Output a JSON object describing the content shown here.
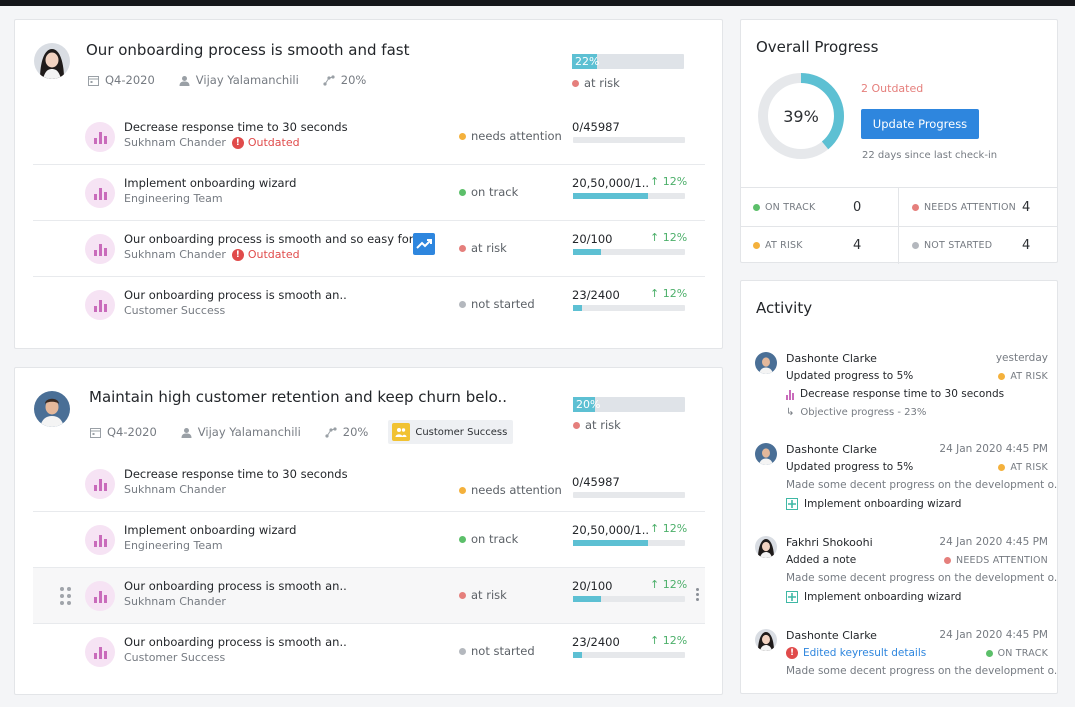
{
  "objectives": [
    {
      "title": "Our onboarding process is smooth and fast",
      "quarter": "Q4-2020",
      "owner": "Vijay Yalamanchili",
      "weight": "20%",
      "tag": "",
      "progress_label": "22%",
      "progress": 0.22,
      "status": "at risk",
      "key_results": [
        {
          "title": "Decrease response time to 30 seconds",
          "owner": "Sukhnam Chander",
          "outdated": "Outdated",
          "status": "needs attention",
          "value": "0/45987",
          "change": "",
          "progress": 0
        },
        {
          "title": "Implement onboarding wizard",
          "owner": "Engineering Team",
          "outdated": "",
          "status": "on track",
          "value": "20,50,000/1..",
          "change": "12%",
          "progress": 0.67
        },
        {
          "title": "Our onboarding process is smooth and so easy for",
          "owner": "Sukhnam Chander",
          "outdated": "Outdated",
          "status": "at risk",
          "value": "20/100",
          "change": "12%",
          "progress": 0.25
        },
        {
          "title": "Our onboarding process is smooth an..",
          "owner": "Customer Success",
          "outdated": "",
          "status": "not started",
          "value": "23/2400",
          "change": "12%",
          "progress": 0.08
        }
      ]
    },
    {
      "title": "Maintain high customer retention and keep churn belo..",
      "quarter": "Q4-2020",
      "owner": "Vijay Yalamanchili",
      "weight": "20%",
      "tag": "Customer Success",
      "progress_label": "20%",
      "progress": 0.2,
      "status": "at risk",
      "key_results": [
        {
          "title": "Decrease response time to 30 seconds",
          "owner": "Sukhnam Chander",
          "outdated": "",
          "status": "needs attention",
          "value": "0/45987",
          "change": "",
          "progress": 0
        },
        {
          "title": "Implement onboarding wizard",
          "owner": "Engineering Team",
          "outdated": "",
          "status": "on track",
          "value": "20,50,000/1..",
          "change": "12%",
          "progress": 0.67
        },
        {
          "title": "Our onboarding process is smooth an..",
          "owner": "Sukhnam Chander",
          "outdated": "",
          "status": "at risk",
          "value": "20/100",
          "change": "12%",
          "progress": 0.25
        },
        {
          "title": "Our onboarding process is smooth an..",
          "owner": "Customer Success",
          "outdated": "",
          "status": "not started",
          "value": "23/2400",
          "change": "12%",
          "progress": 0.08
        }
      ]
    }
  ],
  "overall": {
    "title": "Overall Progress",
    "percent_label": "39%",
    "percent": 0.39,
    "outdated": "2 Outdated",
    "update_button": "Update Progress",
    "checkin": "22 days since last check-in",
    "stats": [
      {
        "label": "ON TRACK",
        "count": "0",
        "color": "#5cbf6a"
      },
      {
        "label": "NEEDS ATTENTION",
        "count": "4",
        "color": "#e57f7c"
      },
      {
        "label": "AT RISK",
        "count": "4",
        "color": "#f4b13c"
      },
      {
        "label": "NOT STARTED",
        "count": "4",
        "color": "#b4b8be"
      }
    ]
  },
  "activity": {
    "title": "Activity",
    "items": [
      {
        "name": "Dashonte Clarke",
        "time": "yesterday",
        "action": "Updated progress to 5%",
        "badge": "AT RISK",
        "line3": "Decrease response time to 30 seconds",
        "line4": "Objective progress - 23%"
      },
      {
        "name": "Dashonte Clarke",
        "time": "24 Jan 2020 4:45 PM",
        "action": "Updated progress to 5%",
        "badge": "AT RISK",
        "line3": "Made some decent progress on the development o.",
        "line4": "Implement onboarding wizard"
      },
      {
        "name": "Fakhri Shokoohi",
        "time": "24 Jan 2020 4:45 PM",
        "action": "Added a note",
        "badge": "NEEDS ATTENTION",
        "line3": "Made some decent progress on the development o.",
        "line4": "Implement onboarding wizard"
      },
      {
        "name": "Dashonte Clarke",
        "time": "24 Jan 2020 4:45 PM",
        "action": "Edited keyresult details",
        "badge": "ON TRACK",
        "line3": "Made some decent progress on the development o.",
        "line4": ""
      }
    ]
  },
  "colors": {
    "accent": "#2e86de",
    "progress": "#5dc0d3",
    "at_risk": "#e57f7c",
    "needs_attention": "#f4b13c",
    "on_track": "#5cbf6a",
    "not_started": "#b4b8be"
  }
}
